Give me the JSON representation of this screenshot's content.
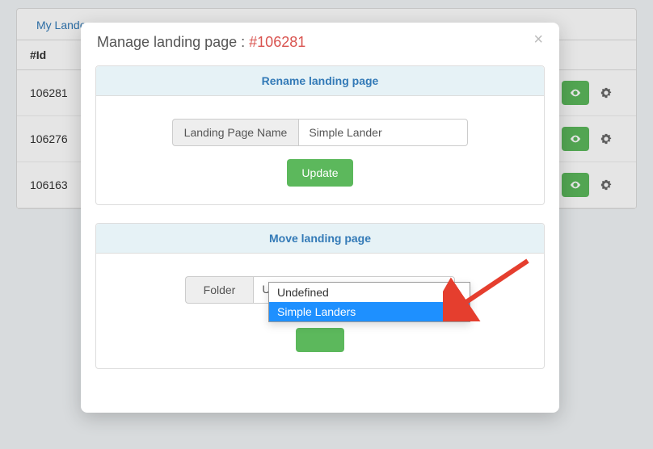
{
  "background": {
    "tab_label": "My Lande",
    "table": {
      "header_id": "#Id",
      "rows": [
        {
          "id": "106281"
        },
        {
          "id": "106276"
        },
        {
          "id": "106163"
        }
      ]
    }
  },
  "modal": {
    "title_prefix": "Manage landing page : ",
    "title_id": "#106281",
    "close_glyph": "×",
    "rename": {
      "header": "Rename landing page",
      "addon_label": "Landing Page Name",
      "value": "Simple Lander",
      "update_label": "Update"
    },
    "move": {
      "header": "Move landing page",
      "addon_label": "Folder",
      "selected": "Undefined",
      "options": [
        "Undefined",
        "Simple Landers"
      ],
      "highlighted_index": 1
    }
  }
}
